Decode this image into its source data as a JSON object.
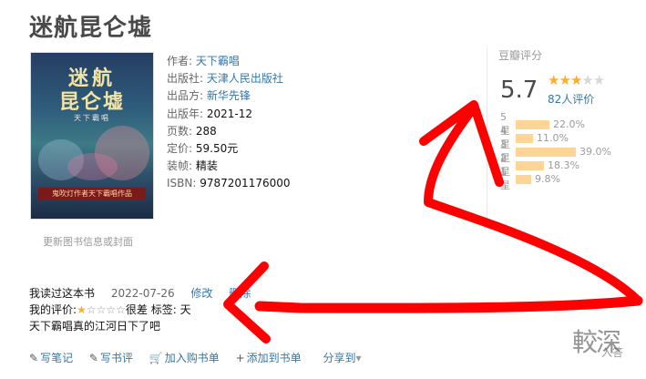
{
  "book": {
    "title": "迷航昆仑墟",
    "cover": {
      "title_line1": "迷航",
      "title_line2": "昆仑墟",
      "subtitle": "天下霸唱",
      "band_text": "鬼吹灯作者天下霸唱作品"
    },
    "update_link": "更新图书信息或封面"
  },
  "info": {
    "author_label": "作者:",
    "author": "天下霸唱",
    "publisher_label": "出版社:",
    "publisher": "天津人民出版社",
    "producer_label": "出品方:",
    "producer": "新华先锋",
    "year_label": "出版年:",
    "year": "2021-12",
    "pages_label": "页数:",
    "pages": "288",
    "price_label": "定价:",
    "price": "59.50元",
    "binding_label": "装帧:",
    "binding": "精装",
    "isbn_label": "ISBN:",
    "isbn": "9787201176000"
  },
  "rating": {
    "title": "豆瓣评分",
    "score": "5.7",
    "stars_filled": 3,
    "stars_total": 5,
    "count": "82人评价",
    "distribution": [
      {
        "label": "5星",
        "percent": "22.0%",
        "value": 22.0
      },
      {
        "label": "4星",
        "percent": "11.0%",
        "value": 11.0
      },
      {
        "label": "3星",
        "percent": "39.0%",
        "value": 39.0
      },
      {
        "label": "2星",
        "percent": "18.3%",
        "value": 18.3
      },
      {
        "label": "1星",
        "percent": "9.8%",
        "value": 9.8
      }
    ]
  },
  "user": {
    "status": "我读过这本书",
    "date": "2022-07-26",
    "edit": "修改",
    "delete": "删除",
    "rating_label": "我的评价:",
    "user_stars": 1,
    "rating_word": "很差",
    "tags_label": "标签:",
    "tags_value": "天",
    "comment": "天下霸唱真的江河日下了吧"
  },
  "actions": {
    "write_note": "写笔记",
    "write_review": "写书评",
    "add_cart": "加入购书单",
    "add_list": "添加到书单",
    "share": "分享到",
    "share_arrow": "▾"
  },
  "watermark": {
    "main": "較深",
    "small": "入答"
  },
  "colors": {
    "accent_link": "#3377aa",
    "star": "#ffac2d",
    "bar": "#ffd596",
    "annotation_red": "#ff0000"
  }
}
